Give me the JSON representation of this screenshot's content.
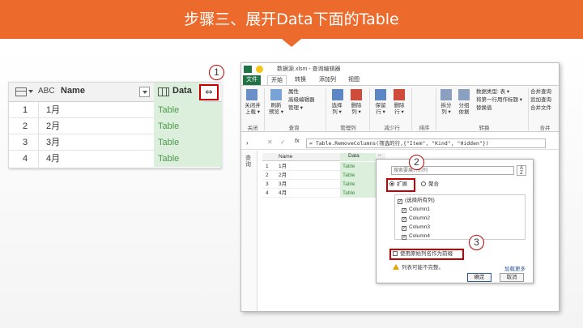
{
  "banner": {
    "title": "步骤三、展开Data下面的Table"
  },
  "left_table": {
    "name_header_type": "ABC",
    "name_header": "Name",
    "data_header": "Data",
    "expand_glyph": "⇔",
    "rows": [
      {
        "num": "1",
        "name": "1月",
        "data": "Table"
      },
      {
        "num": "2",
        "name": "2月",
        "data": "Table"
      },
      {
        "num": "3",
        "name": "3月",
        "data": "Table"
      },
      {
        "num": "4",
        "name": "4月",
        "data": "Table"
      }
    ]
  },
  "callouts": {
    "one": "1",
    "two": "2",
    "three": "3"
  },
  "editor": {
    "title": "数据源.xlsm - 查询编辑器",
    "tabs": [
      "文件",
      "开始",
      "转换",
      "添加列",
      "视图"
    ],
    "ribbon": {
      "close_load": "关闭并\n上载 ▾",
      "refresh": "刷新\n预览 ▾",
      "properties": "属性",
      "advanced_editor": "高级编辑器",
      "manage": "管理 ▾",
      "choose_cols": "选择\n列 ▾",
      "remove_cols": "删除\n列 ▾",
      "keep_rows": "保留\n行 ▾",
      "remove_rows": "删除\n行 ▾",
      "split": "拆分\n列 ▾",
      "group": "分组\n依据",
      "data_type": "数据类型: 表 ▾",
      "first_row_header": "将第一行用作标题 ▾",
      "replace": "替换值",
      "merge_query": "合并查询",
      "append_query": "追加查询",
      "merge_file": "合并文件",
      "groups": [
        "关闭",
        "查询",
        "管理列",
        "减少行",
        "排序",
        "转换",
        "合并"
      ]
    },
    "formula": "= Table.RemoveColumns(筛选的行,{\"Item\", \"Kind\", \"Hidden\"})",
    "sidebar_label": "查询",
    "grid": {
      "name_header": "Name",
      "data_header": "Data",
      "rows": [
        {
          "num": "1",
          "name": "1月",
          "data": "Table"
        },
        {
          "num": "2",
          "name": "2月",
          "data": "Table"
        },
        {
          "num": "3",
          "name": "3月",
          "data": "Table"
        },
        {
          "num": "4",
          "name": "4月",
          "data": "Table"
        }
      ]
    },
    "popup": {
      "search_placeholder": "搜索要展开的列",
      "expand": "扩展",
      "aggregate": "聚合",
      "select_all": "(选择所有列)",
      "columns": [
        "Column1",
        "Column2",
        "Column3",
        "Column4"
      ],
      "use_prefix": "使用原始列名作为前缀",
      "warning": "列表可能不完整。",
      "load_more": "加载更多",
      "ok": "确定",
      "cancel": "取消"
    }
  },
  "colors": {
    "banner": "#ec6a2c",
    "highlight": "#c40000",
    "data_column": "#dcefdc",
    "excel_green": "#217346"
  }
}
